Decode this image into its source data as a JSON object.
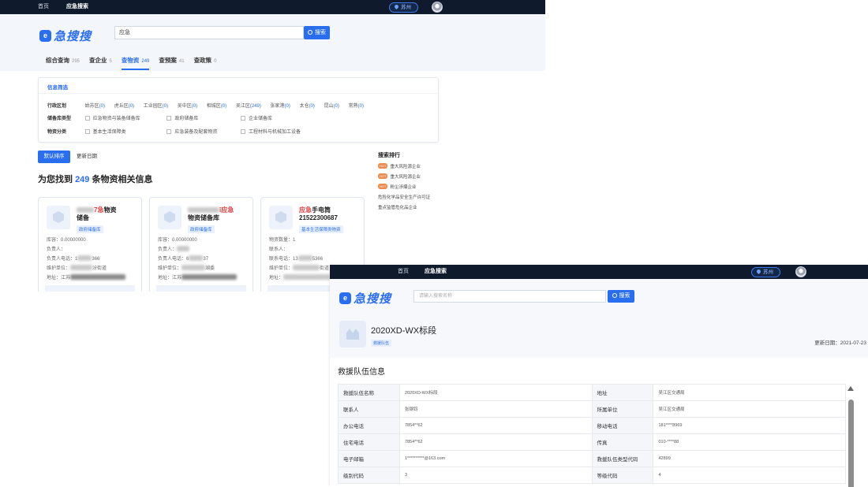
{
  "win1": {
    "nav": [
      "首页",
      "应急搜索"
    ],
    "location": "苏州",
    "logo": "急搜搜",
    "logo_badge": "e",
    "search_value": "应急",
    "search_button": "搜索",
    "tabs": [
      {
        "label": "综合查询",
        "count": "295"
      },
      {
        "label": "查企业",
        "count": "5"
      },
      {
        "label": "查物资",
        "count": "249"
      },
      {
        "label": "查预案",
        "count": "41"
      },
      {
        "label": "查政策",
        "count": "0"
      }
    ],
    "filter": {
      "title": "信息筛选",
      "region_label": "行政区划",
      "regions": [
        {
          "name": "姑苏区",
          "n": "(0)"
        },
        {
          "name": "虎丘区",
          "n": "(0)"
        },
        {
          "name": "工业园区",
          "n": "(0)"
        },
        {
          "name": "吴中区",
          "n": "(0)"
        },
        {
          "name": "相城区",
          "n": "(0)"
        },
        {
          "name": "吴江区",
          "n": "(249)"
        },
        {
          "name": "张家港",
          "n": "(0)"
        },
        {
          "name": "太仓",
          "n": "(0)"
        },
        {
          "name": "昆山",
          "n": "(0)"
        },
        {
          "name": "常熟",
          "n": "(0)"
        }
      ],
      "store_label": "储备库类型",
      "store_types": [
        "应急物资与装备储备库",
        "政府储备库",
        "企业储备库"
      ],
      "cat_label": "物资分类",
      "categories": [
        "基本生活保障类",
        "应急装备及配套物资",
        "工程材料与机械加工设备"
      ]
    },
    "sort": [
      "默认排序",
      "更新日期"
    ],
    "found": {
      "prefix": "为您找到",
      "count": "249",
      "suffix": "条物资相关信息"
    },
    "cards": [
      {
        "title_pre": "",
        "title_red": "7急",
        "title_post": "物资",
        "title_line2": "储备",
        "tag": "政府储备库",
        "rows": [
          {
            "label": "库容：",
            "value": "0.00000000",
            "blur": false
          },
          {
            "label": "负责人：",
            "value": "",
            "blur": false
          },
          {
            "label": "负责人电话：",
            "value": "1",
            "tail": "366",
            "blur": true
          },
          {
            "label": "维护单位：",
            "value": "",
            "tail": "汾街道",
            "blur": true
          },
          {
            "label": "地址：",
            "value": "江苏",
            "tail": "",
            "blur": true
          }
        ]
      },
      {
        "title_pre": "",
        "title_red": "ī应急",
        "title_post": "",
        "title_line2": "物资储备库",
        "tag": "政府储备库",
        "rows": [
          {
            "label": "库容：",
            "value": "0.00000000",
            "blur": false
          },
          {
            "label": "负责人：",
            "value": "",
            "blur": false
          },
          {
            "label": "负责人电话：",
            "value": "6",
            "tail": "37",
            "blur": true
          },
          {
            "label": "维护单位：",
            "value": "",
            "tail": "湖委",
            "blur": true
          },
          {
            "label": "地址：",
            "value": "江苏",
            "tail": "",
            "blur": true
          }
        ]
      },
      {
        "title_pre": "",
        "title_red": "应急",
        "title_post": "手电筒",
        "title_line2": "21522300687",
        "tag": "基本生活保障类物资",
        "rows": [
          {
            "label": "物资数量：",
            "value": "1",
            "blur": false
          },
          {
            "label": "联系人：",
            "value": "",
            "blur": false
          },
          {
            "label": "联系电话：",
            "value": "13",
            "tail": "5366",
            "blur": true
          },
          {
            "label": "维护单位：",
            "value": "",
            "tail": "街道",
            "blur": true
          },
          {
            "label": "地址：",
            "value": "",
            "tail": "",
            "blur": true
          }
        ]
      }
    ],
    "ranking": {
      "title": "搜索排行",
      "items": [
        {
          "hot": "HOT",
          "text": "重大风险源企业"
        },
        {
          "hot": "HOT",
          "text": "重大风险源企业"
        },
        {
          "hot": "HOT",
          "text": "粉尘涉爆企业"
        },
        {
          "hot": "",
          "text": "危险化学品安全生产许可证"
        },
        {
          "hot": "",
          "text": "重点监管危化品企业"
        }
      ]
    }
  },
  "win2": {
    "nav": [
      "首页",
      "应急搜索"
    ],
    "location": "苏州",
    "logo": "急搜搜",
    "logo_badge": "e",
    "search_placeholder": "请输入搜索名称",
    "search_button": "搜索",
    "title": "2020XD-WX标段",
    "tag": "救援队伍",
    "update_label": "更新日期：",
    "update_date": "2021-07-23",
    "section_title": "救援队伍信息",
    "table": [
      [
        "救援队伍名称",
        "2020XD-WX标段",
        "地址",
        "吴江区交通局"
      ],
      [
        "联系人",
        "张钢钧",
        "所属单位",
        "吴江区交通局"
      ],
      [
        "办公电话",
        "7854**62",
        "移动电话",
        "181****8969"
      ],
      [
        "住宅电话",
        "7854**62",
        "传真",
        "010-****88"
      ],
      [
        "电子邮箱",
        "1**********@163.com",
        "救援队伍类型代码",
        "42899"
      ],
      [
        "级别代码",
        "3",
        "等级代码",
        "4"
      ]
    ]
  }
}
